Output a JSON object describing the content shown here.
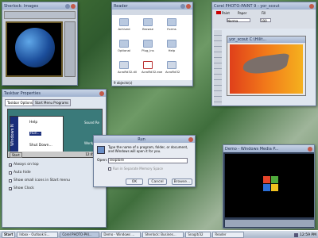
{
  "player": {
    "title": "Sherlock: Images"
  },
  "reader": {
    "title": "Reader",
    "status": "9 objects(s)",
    "items": [
      {
        "label": "Achived",
        "icon": "folder"
      },
      {
        "label": "Browse",
        "icon": "folder"
      },
      {
        "label": "Forms",
        "icon": "folder"
      },
      {
        "label": "Optional",
        "icon": "folder"
      },
      {
        "label": "Plug_ins",
        "icon": "folder"
      },
      {
        "label": "Help",
        "icon": "folder"
      },
      {
        "label": "AcroRd32.dll",
        "icon": "file"
      },
      {
        "label": "AcroRd32.exe",
        "icon": "pdf"
      },
      {
        "label": "AcroRd32",
        "icon": "file"
      }
    ]
  },
  "photopaint": {
    "title": "Corel PHOTO-PAINT 9 - yor_scout",
    "doc_title": "yor_scout C:\\Hilit...",
    "labels": {
      "paint": "Paint",
      "paper": "Paper",
      "fill": "Fill",
      "mode": "Norma",
      "pct": "100"
    }
  },
  "taskbar_props": {
    "title": "Taskbar Properties",
    "tabs": [
      "Taskbar Options",
      "Start Menu Programs"
    ],
    "preview": {
      "items": [
        "Help",
        "Run...",
        "Shut Down..."
      ],
      "side": [
        "Sound Re",
        "Wordpa"
      ],
      "start": "Start",
      "clock": "12:45 PM",
      "brand": "Windows N"
    },
    "options": [
      "Always on top",
      "Auto hide",
      "Show small icons in Start menu",
      "Show Clock"
    ],
    "checked": [
      true,
      false,
      false,
      true
    ]
  },
  "run": {
    "title": "Run",
    "prompt": "Type the name of a program, folder, or document, and Windows will open it for you.",
    "open_label": "Open:",
    "open_value": "iexplore",
    "separate": "Run in Separate Memory Space",
    "ok": "OK",
    "cancel": "Cancel",
    "browse": "Browse..."
  },
  "media": {
    "title": "Demo - Windows Media P..."
  },
  "taskbar": {
    "start": "Start",
    "clock": "12:59 PM",
    "buttons": [
      "Inbox - Outlook E...",
      "Corel PHOTO-PAI...",
      "Demo - Windows ...",
      "Sherlock: Busines...",
      "Snagit/32",
      "Reader"
    ]
  }
}
